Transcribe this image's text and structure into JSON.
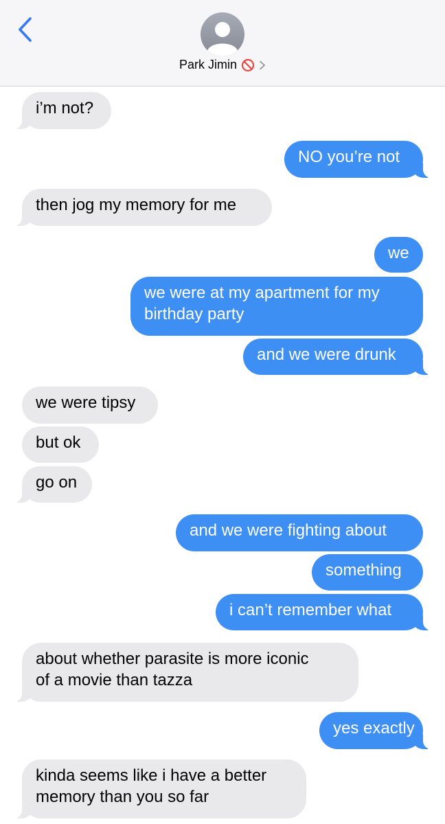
{
  "header": {
    "contact_name": "Park Jimin",
    "back_icon": "chevron-left-icon",
    "blocked_icon": "blocked-icon",
    "disclosure_icon": "chevron-right-icon",
    "accent_color": "#3478f6"
  },
  "colors": {
    "sent_bubble": "#3d8ff4",
    "received_bubble": "#e9e9eb"
  },
  "messages": [
    {
      "direction": "received",
      "text": "i’m not?"
    },
    {
      "direction": "sent",
      "text": "NO you’re not"
    },
    {
      "direction": "received",
      "text": "then jog my memory for me"
    },
    {
      "direction": "sent",
      "text": "we"
    },
    {
      "direction": "sent",
      "text": "we were at my apartment for my\nbirthday party"
    },
    {
      "direction": "sent",
      "text": "and we were drunk"
    },
    {
      "direction": "received",
      "text": "we were tipsy"
    },
    {
      "direction": "received",
      "text": "but ok"
    },
    {
      "direction": "received",
      "text": "go on"
    },
    {
      "direction": "sent",
      "text": "and we were fighting about"
    },
    {
      "direction": "sent",
      "text": "something"
    },
    {
      "direction": "sent",
      "text": "i can’t remember what"
    },
    {
      "direction": "received",
      "text": "about whether parasite is more iconic\nof a movie than tazza"
    },
    {
      "direction": "sent",
      "text": "yes exactly"
    },
    {
      "direction": "received",
      "text": "kinda seems like i have a better\nmemory than you so far"
    }
  ]
}
